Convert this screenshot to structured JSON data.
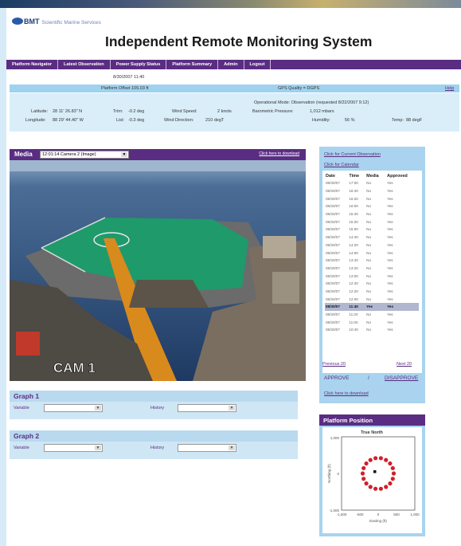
{
  "header": {
    "logo_text": "BMT",
    "logo_subtitle": "Scientific Marine Services",
    "title": "Independent Remote Monitoring System"
  },
  "nav": {
    "items": [
      "Platform Navigator",
      "Latest Observation",
      "Power Supply Status",
      "Platform Summary",
      "Admin",
      "Logout"
    ]
  },
  "status": {
    "timestamp": "8/30/2007 11:40",
    "platform_offset": "Platform Offset 105.03 ft",
    "gps_quality": "GPS Quality = DGPS",
    "help": "Help"
  },
  "readings": {
    "latitude_label": "Latitude:",
    "latitude_value": "28 11' 26.83\" N",
    "longitude_label": "Longitude:",
    "longitude_value": "88 29' 44.40\" W",
    "trim_label": "Trim:",
    "trim_value": "-0.2 deg",
    "list_label": "List:",
    "list_value": "-0.3 deg",
    "wind_speed_label": "Wind Speed:",
    "wind_speed_value": "2 knots",
    "wind_direction_label": "Wind Direction:",
    "wind_direction_value": "210 degT",
    "mode": "Operational Mode: Observation (requested 8/22/2007 9:12)",
    "pressure_label": "Barometric Pressure:",
    "pressure_value": "1,012 mbars",
    "humidity_label": "Humidity:",
    "humidity_value": "56 %",
    "temp_label": "Temp:",
    "temp_value": "88 degF"
  },
  "media": {
    "label": "Media",
    "selected": "12:01:14 Camera 2 (Image)",
    "download": "Click here to download",
    "cam_label": "CAM 1"
  },
  "graphs": [
    {
      "title": "Graph 1",
      "variable_label": "Variable",
      "history_label": "History"
    },
    {
      "title": "Graph 2",
      "variable_label": "Variable",
      "history_label": "History"
    }
  ],
  "observations": {
    "current_link": "Click for Current Observation",
    "calendar_link": "Click for Calendar",
    "headers": [
      "Date",
      "Time",
      "Media",
      "Approved"
    ],
    "rows": [
      [
        "08/30/07",
        "17:00",
        "No",
        "Yes"
      ],
      [
        "08/30/07",
        "16:40",
        "No",
        "Yes"
      ],
      [
        "08/30/07",
        "16:20",
        "No",
        "Yes"
      ],
      [
        "08/30/07",
        "16:00",
        "No",
        "Yes"
      ],
      [
        "08/30/07",
        "15:40",
        "No",
        "Yes"
      ],
      [
        "08/30/07",
        "15:20",
        "No",
        "Yes"
      ],
      [
        "08/30/07",
        "15:00",
        "No",
        "Yes"
      ],
      [
        "08/30/07",
        "14:40",
        "No",
        "Yes"
      ],
      [
        "08/30/07",
        "14:20",
        "No",
        "Yes"
      ],
      [
        "08/30/07",
        "14:00",
        "No",
        "Yes"
      ],
      [
        "08/30/07",
        "13:40",
        "No",
        "Yes"
      ],
      [
        "08/30/07",
        "13:20",
        "No",
        "Yes"
      ],
      [
        "08/30/07",
        "13:00",
        "No",
        "Yes"
      ],
      [
        "08/30/07",
        "12:40",
        "No",
        "Yes"
      ],
      [
        "08/30/07",
        "12:20",
        "No",
        "Yes"
      ],
      [
        "08/30/07",
        "12:00",
        "No",
        "Yes"
      ],
      [
        "08/30/07",
        "11:40",
        "Yes",
        "Yes"
      ],
      [
        "08/30/07",
        "11:20",
        "No",
        "Yes"
      ],
      [
        "08/30/07",
        "11:00",
        "No",
        "Yes"
      ],
      [
        "08/30/07",
        "10:40",
        "No",
        "Yes"
      ]
    ],
    "selected_index": 16,
    "previous": "Previous 20",
    "next": "Next 20",
    "approve": "APPROVE",
    "separator": "/",
    "disapprove": "DISAPPROVE",
    "download": "Click here to download"
  },
  "platform_position": {
    "title": "Platform Position",
    "plot_title": "True North",
    "y_axis_label": "Northing (ft)",
    "x_axis_label": "Easting (ft)",
    "y_ticks": [
      "1,000",
      "0",
      "-1,000"
    ],
    "x_ticks": [
      "-1,000",
      "-500",
      "0",
      "500",
      "1,000"
    ],
    "ring_color": "#d0202a",
    "current_marker_color": "#111111"
  },
  "colors": {
    "nav_purple": "#5a2d82",
    "panel_blue": "#a9d3ee",
    "info_blue": "#d9eef9"
  }
}
